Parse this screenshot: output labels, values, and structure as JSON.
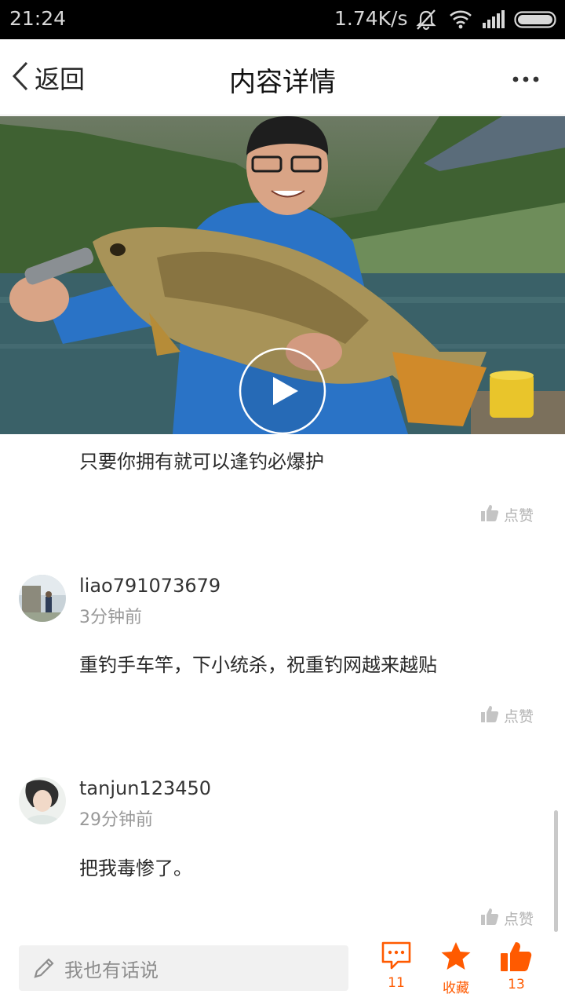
{
  "status_bar": {
    "time": "21:24",
    "network_speed": "1.74K/s",
    "icons": [
      "mute-icon",
      "wifi-icon",
      "signal-icon",
      "battery-icon"
    ]
  },
  "header": {
    "back_label": "返回",
    "title": "内容详情",
    "more_icon": "more-dots-icon"
  },
  "video": {
    "play_icon": "play-icon"
  },
  "post": {
    "text": "只要你拥有就可以逢钓必爆护",
    "like_label": "点赞"
  },
  "comments": [
    {
      "username": "liao791073679",
      "time": "3分钟前",
      "text": "重钓手车竿，下小统杀，祝重钓网越来越贴",
      "like_label": "点赞"
    },
    {
      "username": "tanjun123450",
      "time": "29分钟前",
      "text": "把我毒惨了。",
      "like_label": "点赞"
    }
  ],
  "bottom_bar": {
    "input_placeholder": "我也有话说",
    "comment_count": "11",
    "favorite_label": "收藏",
    "like_count": "13"
  },
  "colors": {
    "accent": "#ff5a00",
    "muted": "#b3b3b3"
  }
}
